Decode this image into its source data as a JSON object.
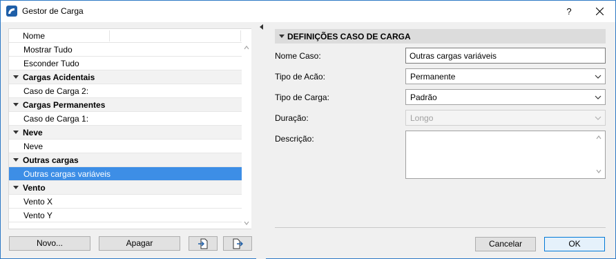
{
  "window": {
    "title": "Gestor de Carga",
    "help_label": "?"
  },
  "list": {
    "header": "Nome",
    "rows": [
      {
        "label": "Mostrar Tudo",
        "type": "item"
      },
      {
        "label": "Esconder Tudo",
        "type": "item"
      },
      {
        "label": "Cargas Acidentais",
        "type": "group"
      },
      {
        "label": "Caso de Carga 2:",
        "type": "item"
      },
      {
        "label": "Cargas Permanentes",
        "type": "group"
      },
      {
        "label": "Caso de Carga 1:",
        "type": "item"
      },
      {
        "label": "Neve",
        "type": "group"
      },
      {
        "label": "Neve",
        "type": "item"
      },
      {
        "label": "Outras cargas",
        "type": "group"
      },
      {
        "label": "Outras cargas variáveis",
        "type": "item",
        "selected": true
      },
      {
        "label": "Vento",
        "type": "group"
      },
      {
        "label": "Vento X",
        "type": "item"
      },
      {
        "label": "Vento Y",
        "type": "item"
      }
    ]
  },
  "buttons": {
    "new": "Novo...",
    "delete": "Apagar",
    "cancel": "Cancelar",
    "ok": "OK"
  },
  "section": {
    "title": "DEFINIÇÕES CASO DE CARGA"
  },
  "fields": {
    "name_label": "Nome Caso:",
    "name_value": "Outras cargas variáveis",
    "action_label": "Tipo de Acão:",
    "action_value": "Permanente",
    "load_label": "Tipo de Carga:",
    "load_value": "Padrão",
    "duration_label": "Duração:",
    "duration_value": "Longo",
    "description_label": "Descrição:"
  },
  "colors": {
    "selection": "#3d8ee6",
    "accent_border": "#0078d7"
  }
}
